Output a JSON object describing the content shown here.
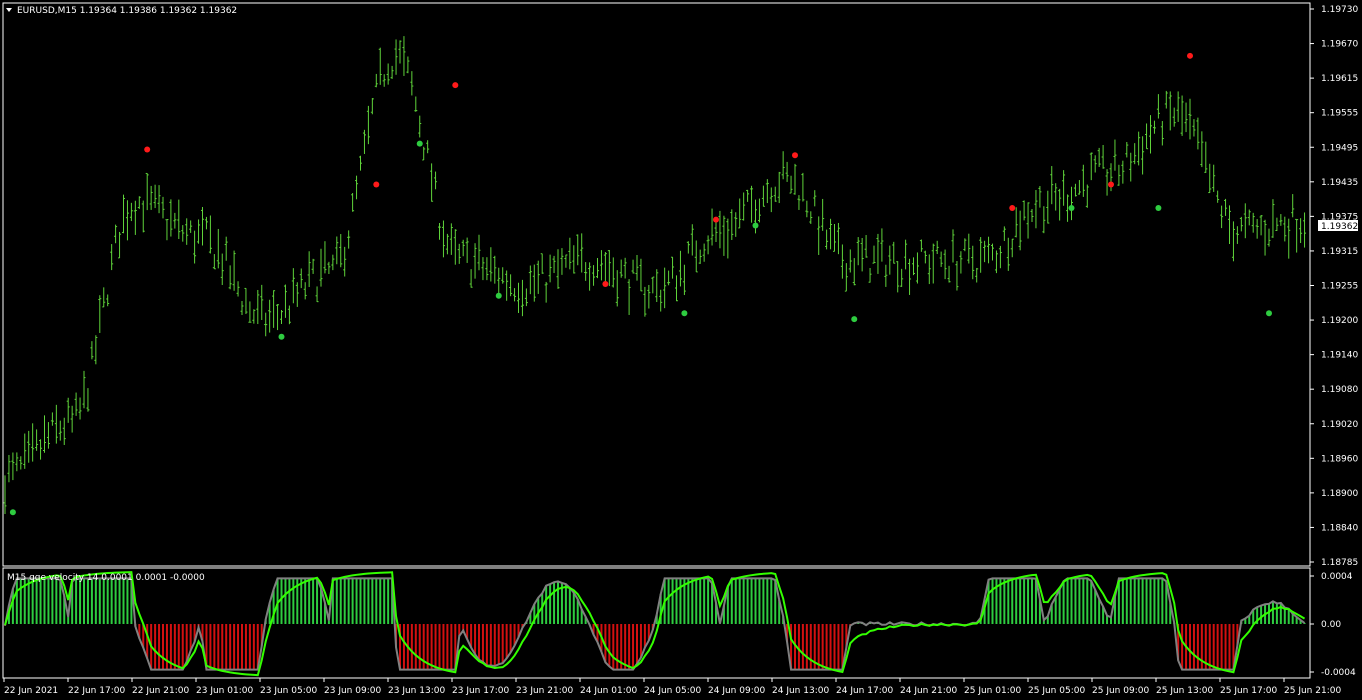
{
  "main_chart": {
    "symbol_label": "EURUSD,M15  1.19364 1.19386 1.19362 1.19362",
    "current_price_label": "1.19362",
    "price_axis_labels": [
      "1.19730",
      "1.19670",
      "1.19615",
      "1.19555",
      "1.19495",
      "1.19435",
      "1.19375",
      "1.19315",
      "1.19255",
      "1.19200",
      "1.19140",
      "1.19080",
      "1.19020",
      "1.18960",
      "1.18900",
      "1.18840",
      "1.18785"
    ],
    "bar_color": "#5fd33a",
    "buy_dot_color": "#2ecc40",
    "sell_dot_color": "#ff1a1a"
  },
  "indicator": {
    "label": "M15 qqe velocity 14 0.0001 0.0001 -0.0000",
    "axis_labels": [
      "0.0004",
      "0.00",
      "-0.0004"
    ],
    "positive_color": "#2ecc40",
    "negative_color": "#d41010",
    "fast_line_color": "#33ff00",
    "slow_line_color": "#808080"
  },
  "time_axis_labels": [
    "22 Jun 2021",
    "22 Jun 17:00",
    "22 Jun 21:00",
    "23 Jun 01:00",
    "23 Jun 05:00",
    "23 Jun 09:00",
    "23 Jun 13:00",
    "23 Jun 17:00",
    "23 Jun 21:00",
    "24 Jun 01:00",
    "24 Jun 05:00",
    "24 Jun 09:00",
    "24 Jun 13:00",
    "24 Jun 17:00",
    "24 Jun 21:00",
    "25 Jun 01:00",
    "25 Jun 05:00",
    "25 Jun 09:00",
    "25 Jun 13:00",
    "25 Jun 17:00",
    "25 Jun 21:00"
  ],
  "chart_data": {
    "type": "line",
    "title": "EURUSD,M15",
    "price_anchor_points": {
      "x_labels": [
        "22 Jun 2021",
        "22 Jun 17:00",
        "22 Jun 21:00",
        "23 Jun 01:00",
        "23 Jun 05:00",
        "23 Jun 09:00",
        "23 Jun 13:00",
        "23 Jun 17:00",
        "23 Jun 21:00",
        "24 Jun 01:00",
        "24 Jun 05:00",
        "24 Jun 09:00",
        "24 Jun 13:00",
        "24 Jun 17:00",
        "24 Jun 21:00",
        "25 Jun 01:00",
        "25 Jun 05:00",
        "25 Jun 09:00",
        "25 Jun 13:00",
        "25 Jun 17:00",
        "25 Jun 21:00"
      ],
      "values": [
        1.1893,
        1.1902,
        1.194,
        1.1934,
        1.192,
        1.1928,
        1.1965,
        1.193,
        1.1926,
        1.193,
        1.1925,
        1.1935,
        1.1944,
        1.193,
        1.193,
        1.193,
        1.194,
        1.1945,
        1.1955,
        1.1935,
        1.1937
      ]
    },
    "ylim": [
      1.18785,
      1.1973
    ],
    "buy_signals_price": [
      1.1887,
      1.1917,
      1.195,
      1.1924,
      1.1921,
      1.1936,
      1.192,
      1.1939,
      1.1939,
      1.1921
    ],
    "sell_signals_price": [
      1.1949,
      1.1943,
      1.196,
      1.1926,
      1.1937,
      1.1948,
      1.1939,
      1.1943,
      1.1965
    ],
    "indicator_ylim": [
      -0.0004,
      0.0004
    ]
  }
}
